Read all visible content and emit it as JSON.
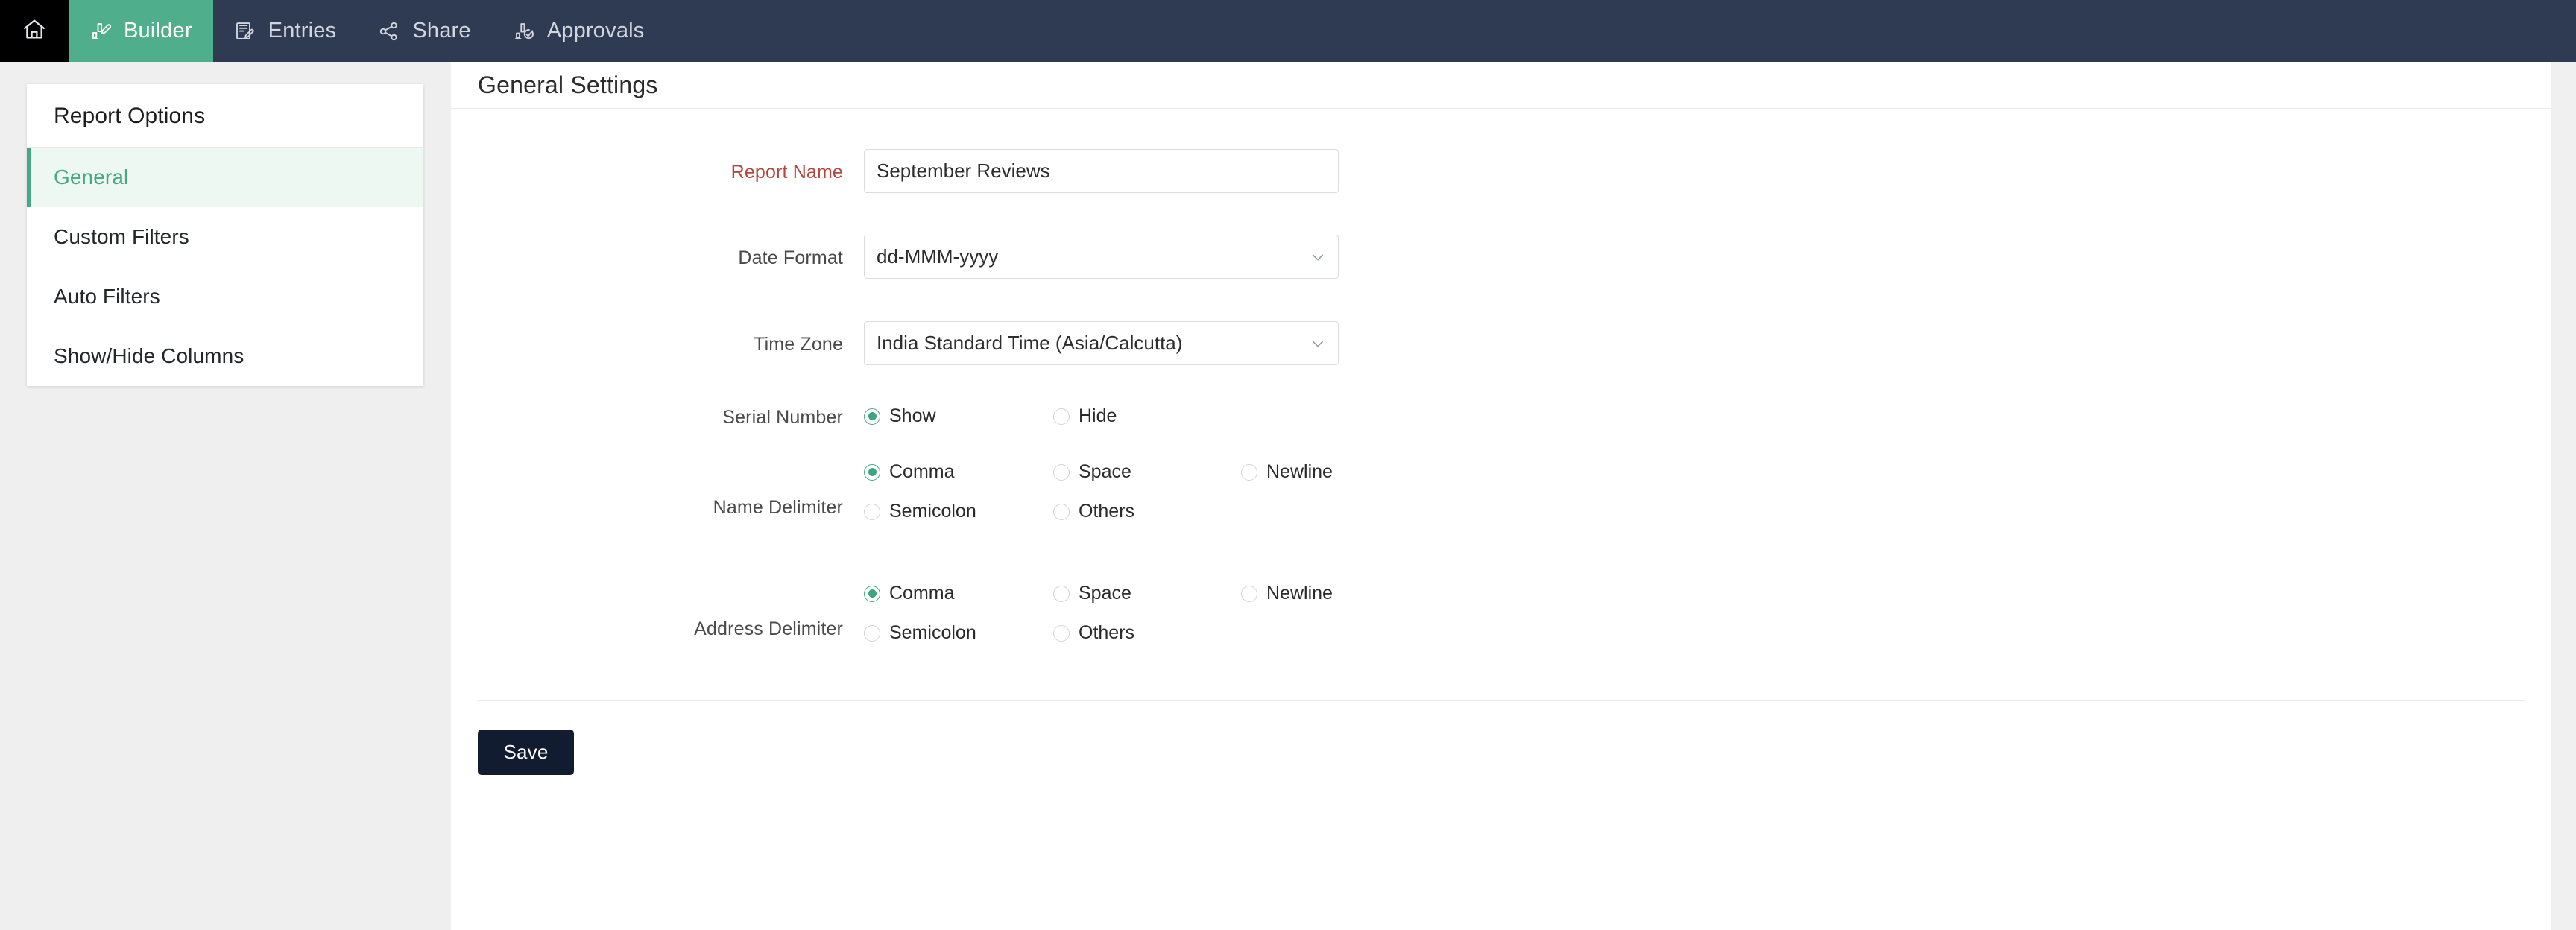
{
  "topnav": {
    "home_icon": "home-icon",
    "items": [
      {
        "label": "Builder",
        "icon": "builder-chart-pencil-icon",
        "active": true
      },
      {
        "label": "Entries",
        "icon": "entries-document-pencil-icon",
        "active": false
      },
      {
        "label": "Share",
        "icon": "share-nodes-icon",
        "active": false
      },
      {
        "label": "Approvals",
        "icon": "approvals-chart-check-icon",
        "active": false
      }
    ]
  },
  "sidebar": {
    "title": "Report Options",
    "items": [
      {
        "label": "General",
        "selected": true
      },
      {
        "label": "Custom Filters",
        "selected": false
      },
      {
        "label": "Auto Filters",
        "selected": false
      },
      {
        "label": "Show/Hide Columns",
        "selected": false
      }
    ]
  },
  "main": {
    "title": "General Settings",
    "fields": {
      "report_name": {
        "label": "Report Name",
        "required": true,
        "value": "September Reviews",
        "placeholder": ""
      },
      "date_format": {
        "label": "Date Format",
        "value": "dd-MMM-yyyy"
      },
      "time_zone": {
        "label": "Time Zone",
        "value": "India Standard Time   (Asia/Calcutta)"
      },
      "serial_number": {
        "label": "Serial Number",
        "options": [
          {
            "label": "Show",
            "selected": true
          },
          {
            "label": "Hide",
            "selected": false
          }
        ]
      },
      "name_delimiter": {
        "label": "Name Delimiter",
        "row1": [
          {
            "label": "Comma",
            "selected": true
          },
          {
            "label": "Space",
            "selected": false
          },
          {
            "label": "Newline",
            "selected": false
          }
        ],
        "row2": [
          {
            "label": "Semicolon",
            "selected": false
          },
          {
            "label": "Others",
            "selected": false
          }
        ]
      },
      "address_delimiter": {
        "label": "Address Delimiter",
        "row1": [
          {
            "label": "Comma",
            "selected": true
          },
          {
            "label": "Space",
            "selected": false
          },
          {
            "label": "Newline",
            "selected": false
          }
        ],
        "row2": [
          {
            "label": "Semicolon",
            "selected": false
          },
          {
            "label": "Others",
            "selected": false
          }
        ]
      }
    },
    "save_label": "Save"
  },
  "colors": {
    "nav_bg": "#2f3b52",
    "accent_green": "#45a986",
    "required_red": "#b3473f",
    "save_dark": "#111c30",
    "page_bg": "#efeff0"
  }
}
